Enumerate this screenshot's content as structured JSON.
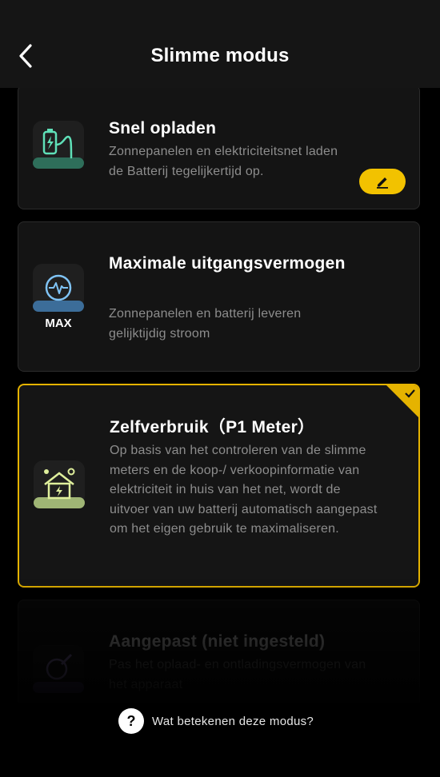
{
  "header": {
    "title": "Slimme modus",
    "back_icon": "chevron-left-icon"
  },
  "modes": [
    {
      "title": "Snel opladen",
      "description": "Zonnepanelen en elektriciteitsnet laden de Batterij tegelijkertijd op.",
      "icon": "battery-plug-icon",
      "edit_icon": "pencil-icon"
    },
    {
      "title": "Maximale uitgangsvermogen",
      "description": "Zonnepanelen en batterij leveren gelijktijdig stroom",
      "icon": "pulse-icon",
      "icon_label": "MAX"
    },
    {
      "title": "Zelfverbruik（P1 Meter）",
      "description": "Op basis van het controleren van de slimme meters en de koop-/ verkoopinformatie van elektriciteit in huis van het net, wordt de uitvoer van uw batterij automatisch aangepast om het eigen gebruik te maximaliseren.",
      "icon": "solar-house-icon",
      "selected": true
    },
    {
      "title": "Aangepast (niet ingesteld)",
      "description": "Pas het oplaad- en ontladingsvermogen van het apparaat",
      "icon": "custom-settings-icon"
    }
  ],
  "footer": {
    "help_text": "Wat betekenen deze modus?",
    "help_icon": "question-icon"
  },
  "colors": {
    "accent": "#F2C200",
    "card_bg": "#141414",
    "text_secondary": "#8D8D8D"
  }
}
